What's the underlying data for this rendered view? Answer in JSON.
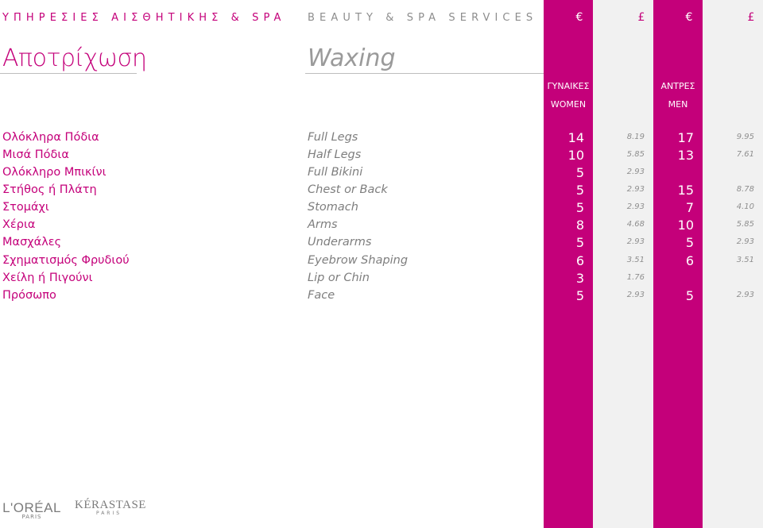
{
  "header": {
    "greek": "ΥΠΗΡΕΣΙΕΣ ΑΙΣΘΗΤΙΚΗΣ & SPA",
    "english": "BEAUTY & SPA SERVICES",
    "currency_euro": "€",
    "currency_pound": "£"
  },
  "title": {
    "greek": "Αποτρίχωση",
    "english": "Waxing"
  },
  "columns": {
    "women_gr": "ΓΥΝΑΙΚΕΣ",
    "women_en": "WOMEN",
    "men_gr": "ΑΝΤΡΕΣ",
    "men_en": "MEN"
  },
  "services": [
    {
      "gr": "Ολόκληρα Πόδια",
      "en": "Full Legs",
      "women_eur": "14",
      "women_gbp": "8.19",
      "men_eur": "17",
      "men_gbp": "9.95"
    },
    {
      "gr": "Μισά Πόδια",
      "en": "Half Legs",
      "women_eur": "10",
      "women_gbp": "5.85",
      "men_eur": "13",
      "men_gbp": "7.61"
    },
    {
      "gr": "Ολόκληρο Μπικίνι",
      "en": "Full Bikini",
      "women_eur": "5",
      "women_gbp": "2.93",
      "men_eur": "",
      "men_gbp": ""
    },
    {
      "gr": "Στήθος ή Πλάτη",
      "en": "Chest or Back",
      "women_eur": "5",
      "women_gbp": "2.93",
      "men_eur": "15",
      "men_gbp": "8.78"
    },
    {
      "gr": "Στομάχι",
      "en": "Stomach",
      "women_eur": "5",
      "women_gbp": "2.93",
      "men_eur": "7",
      "men_gbp": "4.10"
    },
    {
      "gr": "Χέρια",
      "en": "Arms",
      "women_eur": "8",
      "women_gbp": "4.68",
      "men_eur": "10",
      "men_gbp": "5.85"
    },
    {
      "gr": "Μασχάλες",
      "en": "Underarms",
      "women_eur": "5",
      "women_gbp": "2.93",
      "men_eur": "5",
      "men_gbp": "2.93"
    },
    {
      "gr": "Σχηματισμός Φρυδιού",
      "en": "Eyebrow Shaping",
      "women_eur": "6",
      "women_gbp": "3.51",
      "men_eur": "6",
      "men_gbp": "3.51"
    },
    {
      "gr": "Χείλη ή Πιγούνι",
      "en": "Lip or Chin",
      "women_eur": "3",
      "women_gbp": "1.76",
      "men_eur": "",
      "men_gbp": ""
    },
    {
      "gr": "Πρόσωπο",
      "en": "Face",
      "women_eur": "5",
      "women_gbp": "2.93",
      "men_eur": "5",
      "men_gbp": "2.93"
    }
  ],
  "footer": {
    "logo1_main": "L'ORÉAL",
    "logo1_sub": "PARIS",
    "logo2_main": "KÉRASTASE",
    "logo2_sub": "PARIS"
  },
  "colors": {
    "accent": "#c4007a",
    "grey_column": "#f1f1f1"
  }
}
